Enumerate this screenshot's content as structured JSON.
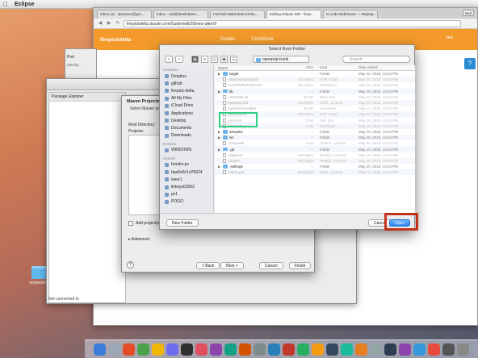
{
  "menubar": {
    "apple": "",
    "app_name": "Eclipse"
  },
  "desktop": {
    "folder_label": "screenshots"
  },
  "browser": {
    "tabs": [
      "Inbox (4) - njensen1@gm...",
      "Inbox - neil@timefrakers...",
      "FirePick Delta Beta Kit Bu...",
      "Editing Eclipse IDE - firep...",
      "G-code Reference — Reprap..."
    ],
    "user_badge": "Neil",
    "url": "firepickdelta.dozuki.com/Guide/edit/35/new-after/9",
    "site_logo": "firepickdelta",
    "nav_guides": "Guides",
    "nav_contribute": "Contribute",
    "account": "Neil",
    "help_glyph": "?"
  },
  "tiny_window": {
    "text1": "Port",
    "text2": "/dev/tty..."
  },
  "eclipse": {
    "package_explorer": "Package Explorer",
    "status": "Not connected to"
  },
  "maven": {
    "title": "Maven Projects",
    "subtitle": "Select Maven projects",
    "root_label": "Root Directory:",
    "projects_label": "Projects:",
    "add_working_set": "Add project(s) to",
    "advanced": "Advanced",
    "back": "< Back",
    "next": "Next >",
    "cancel": "Cancel",
    "finish": "Finish",
    "help": "?"
  },
  "picker": {
    "title": "Select Root Folder",
    "folder": "openpnp-trunk",
    "search_placeholder": "Search",
    "columns": {
      "name": "Name",
      "size": "Size",
      "kind": "Kind",
      "date": "Date Added"
    },
    "sections": {
      "favorites": "Favorites",
      "devices": "Devices",
      "shared": "Shared"
    },
    "favorites": [
      "Dropbox",
      "github",
      "firepick-delta",
      "All My Files",
      "iCloud Drive",
      "Applications",
      "Desktop",
      "Documents",
      "Downloads"
    ],
    "devices": [
      "WINDOWS"
    ],
    "shared": [
      "brooks-pc",
      "hpa0d3c1d79624",
      "laser1",
      "linksys03052",
      "pc1",
      "POGO"
    ],
    "files": [
      {
        "name": "target",
        "type": "folder",
        "expand": true,
        "size": "--",
        "kind": "Folder",
        "date": "May 10, 2015, 12:54 PM",
        "dim": false
      },
      {
        "name": ".cloud-snapshot.sh",
        "type": "file",
        "expand": false,
        "size": "414 bytes",
        "kind": "shell script",
        "date": "May 10, 2015, 12:54 PM",
        "dim": true
      },
      {
        "name": "CONTRIBUTING.md",
        "type": "file",
        "expand": false,
        "size": "291 bytes",
        "kind": "Markdown",
        "date": "May 10, 2015, 12:54 PM",
        "dim": true
      },
      {
        "name": "lib",
        "type": "folder",
        "expand": true,
        "size": "--",
        "kind": "Folder",
        "date": "May 10, 2015, 12:54 PM",
        "dim": false
      },
      {
        "name": "LICENSE.txt",
        "type": "file",
        "expand": false,
        "size": "35 KB",
        "kind": "Plain Text",
        "date": "May 10, 2015, 12:54 PM",
        "dim": true
      },
      {
        "name": "openpnp.bat",
        "type": "file",
        "expand": false,
        "size": "311 bytes",
        "kind": "Subli...cument",
        "date": "May 10, 2015, 12:54 PM",
        "dim": true
      },
      {
        "name": "OpenPnPInstaller",
        "type": "file",
        "expand": false,
        "size": "30 KB",
        "kind": "Document",
        "date": "May 10, 2015, 12:54 PM",
        "dim": true
      },
      {
        "name": "openpnp.sh",
        "type": "file",
        "expand": false,
        "size": "488 bytes",
        "kind": "shell script",
        "date": "May 10, 2015, 12:54 PM",
        "dim": true
      },
      {
        "name": "pom.xml",
        "type": "file",
        "expand": false,
        "size": "7 KB",
        "kind": "XML text",
        "date": "May 10, 2015, 12:54 PM",
        "dim": true
      },
      {
        "name": "README.md",
        "type": "file",
        "expand": false,
        "size": "2 KB",
        "kind": "Markdown",
        "date": "May 10, 2015, 12:54 PM",
        "dim": true
      },
      {
        "name": "samples",
        "type": "folder",
        "expand": true,
        "size": "--",
        "kind": "Folder",
        "date": "May 10, 2015, 12:54 PM",
        "dim": false
      },
      {
        "name": "src",
        "type": "folder",
        "expand": true,
        "size": "--",
        "kind": "Folder",
        "date": "May 10, 2015, 12:54 PM",
        "dim": false
      },
      {
        "name": ".classpath",
        "type": "file",
        "expand": false,
        "size": "1 KB",
        "kind": "TextEd...cument",
        "date": "May 10, 2015, 12:54 PM",
        "dim": true
      },
      {
        "name": ".git",
        "type": "folder",
        "expand": true,
        "size": "--",
        "kind": "Folder",
        "date": "May 10, 2015, 12:54 PM",
        "dim": false
      },
      {
        "name": ".gitignore",
        "type": "file",
        "expand": false,
        "size": "159 bytes",
        "kind": "TextEd...cument",
        "date": "May 10, 2015, 12:54 PM",
        "dim": true
      },
      {
        "name": ".project",
        "type": "file",
        "expand": false,
        "size": "540 bytes",
        "kind": "TextEd...cument",
        "date": "May 10, 2015, 12:54 PM",
        "dim": true
      },
      {
        "name": ".settings",
        "type": "folder",
        "expand": true,
        "size": "--",
        "kind": "Folder",
        "date": "May 10, 2015, 12:54 PM",
        "dim": false
      },
      {
        "name": ".travis.yml",
        "type": "file",
        "expand": false,
        "size": "863 bytes",
        "kind": "Subli...cument",
        "date": "May 10, 2015, 12:54 PM",
        "dim": true
      }
    ],
    "new_folder": "New Folder",
    "cancel": "Cancel",
    "open": "Open"
  },
  "dock": {
    "count_apps": 26
  },
  "colors": {
    "brand_orange": "#f39a2b",
    "highlight_green": "#2bd183",
    "highlight_red": "#c1341b",
    "primary_blue": "#2a84f0"
  }
}
